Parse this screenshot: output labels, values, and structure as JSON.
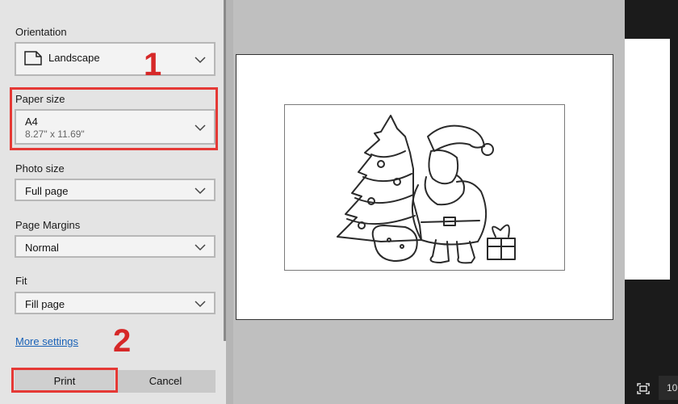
{
  "settings": {
    "orientation": {
      "label": "Orientation",
      "value": "Landscape",
      "icon": "page-landscape-icon"
    },
    "paper_size": {
      "label": "Paper size",
      "value": "A4",
      "subvalue": "8.27\" x 11.69\""
    },
    "photo_size": {
      "label": "Photo size",
      "value": "Full page"
    },
    "page_margins": {
      "label": "Page Margins",
      "value": "Normal"
    },
    "fit": {
      "label": "Fit",
      "value": "Fill page"
    },
    "more_settings": "More settings"
  },
  "buttons": {
    "print": "Print",
    "cancel": "Cancel"
  },
  "annotations": {
    "step1": "1",
    "step2": "2"
  },
  "status": {
    "zoom_fragment": "10"
  },
  "colors": {
    "highlight": "#e53935",
    "step_number": "#d62828",
    "link": "#1a62b7"
  }
}
